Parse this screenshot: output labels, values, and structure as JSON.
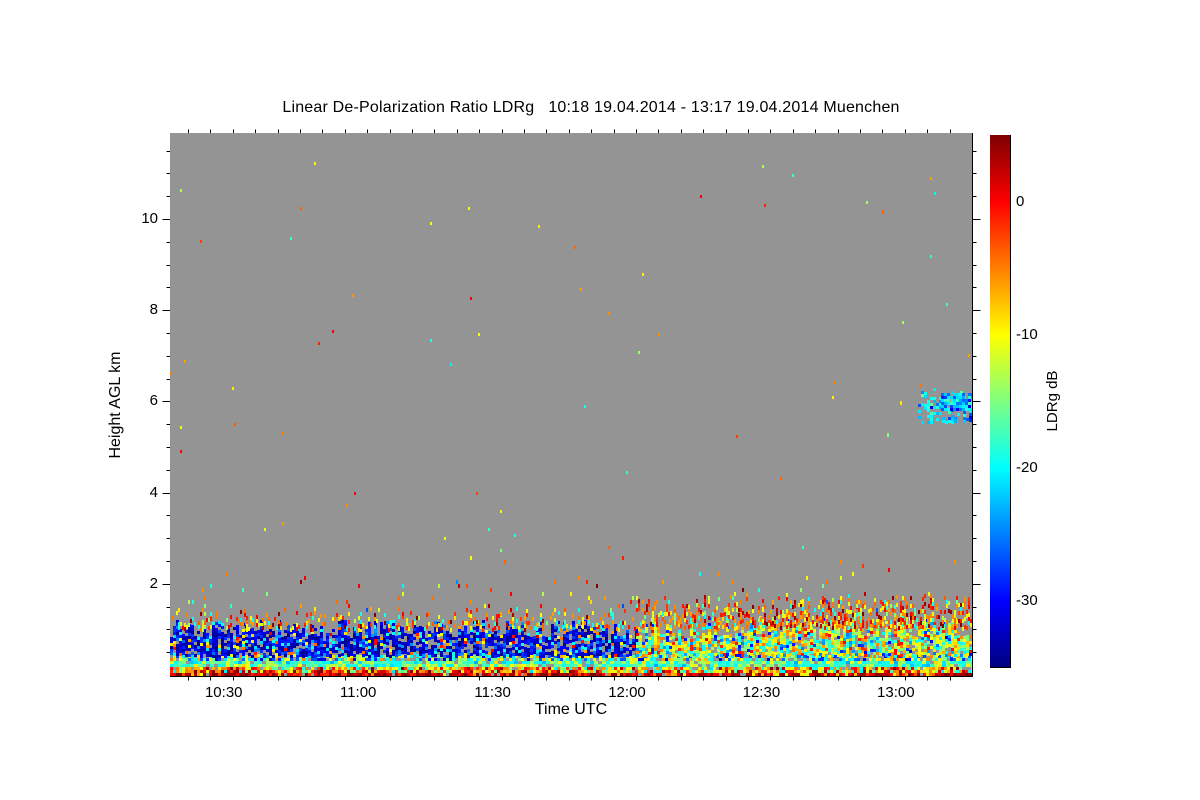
{
  "chart": {
    "title": "Linear De-Polarization Ratio LDRg   10:18 19.04.2014 - 13:17 19.04.2014 Muenchen",
    "x_axis": {
      "label": "Time UTC",
      "start_time": "10:18",
      "end_time": "13:17",
      "duration_min": 179,
      "major_ticks": [
        {
          "label": "10:30",
          "t_min": 12
        },
        {
          "label": "11:00",
          "t_min": 42
        },
        {
          "label": "11:30",
          "t_min": 72
        },
        {
          "label": "12:00",
          "t_min": 102
        },
        {
          "label": "12:30",
          "t_min": 132
        },
        {
          "label": "13:00",
          "t_min": 162
        }
      ],
      "minor_tick_every_min": 5
    },
    "y_axis": {
      "label": "Height AGL km",
      "min_km": 0,
      "max_km": 11.9,
      "major_ticks": [
        2,
        4,
        6,
        8,
        10
      ],
      "minor_tick_every_km": 0.5
    },
    "colorbar": {
      "label": "LDRg dB",
      "max_db": 5,
      "min_db": -35,
      "major_ticks": [
        0,
        -10,
        -20,
        -30
      ],
      "minor_tick_every_db": 2,
      "colormap": "jet"
    },
    "colors": {
      "background": "#ffffff",
      "plot_no_data": "#949494",
      "axis": "#000000",
      "text": "#000000"
    }
  },
  "chart_data": {
    "type": "heatmap",
    "quantity": "Linear De-Polarization Ratio LDRg (dB)",
    "site": "Muenchen",
    "date": "19.04.2014",
    "time_range_utc": [
      "10:18",
      "13:17"
    ],
    "height_range_km": [
      0,
      11.9
    ],
    "value_range_db": [
      -35,
      5
    ],
    "no_data": "grey above boundary layer except isolated specks and one mid-level cloud patch",
    "bands": [
      {
        "name": "surface-clutter-line",
        "t": [
          0,
          179
        ],
        "h": [
          0.0,
          0.1
        ],
        "fill": 0.97,
        "cell": [
          3,
          3
        ],
        "values": [
          [
            4,
            0.5
          ],
          [
            1,
            0.25
          ],
          [
            -2,
            0.12
          ],
          [
            -6,
            0.08
          ],
          [
            -10,
            0.05
          ]
        ]
      },
      {
        "name": "near-surface-mixed",
        "t": [
          0,
          179
        ],
        "h": [
          0.1,
          0.18
        ],
        "fill": 0.85,
        "cell": [
          3,
          3
        ],
        "values": [
          [
            -6,
            0.25
          ],
          [
            -10,
            0.25
          ],
          [
            -1,
            0.18
          ],
          [
            4,
            0.1
          ],
          [
            -16,
            0.12
          ],
          [
            -20,
            0.1
          ]
        ]
      },
      {
        "name": "low-cyan-green-stripe",
        "t": [
          0,
          179
        ],
        "h": [
          0.18,
          0.31
        ],
        "fill": 0.92,
        "cell": [
          4,
          3
        ],
        "values": [
          [
            -19,
            0.4
          ],
          [
            -16,
            0.25
          ],
          [
            -13,
            0.18
          ],
          [
            -10,
            0.1
          ],
          [
            -22,
            0.07
          ]
        ]
      },
      {
        "name": "transition-stripe",
        "t": [
          0,
          179
        ],
        "h": [
          0.31,
          0.44
        ],
        "fill": 0.8,
        "cell": [
          3,
          3
        ],
        "values": [
          [
            -20,
            0.25
          ],
          [
            -10,
            0.22
          ],
          [
            -27,
            0.18
          ],
          [
            -15,
            0.15
          ],
          [
            -6,
            0.1
          ],
          [
            -31,
            0.1
          ]
        ]
      },
      {
        "name": "boundary-layer-blue-morning",
        "t": [
          0,
          104
        ],
        "h": [
          0.44,
          1.02
        ],
        "fill": 0.86,
        "cell": [
          3,
          3
        ],
        "top_jitter": 0.2,
        "values": [
          [
            -33,
            0.42
          ],
          [
            -29,
            0.28
          ],
          [
            -25,
            0.1
          ],
          [
            -20,
            0.09
          ],
          [
            -10,
            0.05
          ],
          [
            -5,
            0.04
          ],
          [
            0,
            0.02
          ]
        ]
      },
      {
        "name": "boundary-layer-warm-noon",
        "t": [
          104,
          179
        ],
        "h": [
          0.44,
          1.05
        ],
        "fill": 0.86,
        "cell": [
          3,
          3
        ],
        "top_jitter": 0.25,
        "values": [
          [
            -10,
            0.26
          ],
          [
            -19,
            0.22
          ],
          [
            -14,
            0.18
          ],
          [
            -6,
            0.14
          ],
          [
            -1,
            0.07
          ],
          [
            -24,
            0.07
          ],
          [
            -29,
            0.06
          ]
        ]
      },
      {
        "name": "fringe-morning",
        "t": [
          0,
          104
        ],
        "h": [
          1.02,
          1.32
        ],
        "fill": 0.32,
        "cell": [
          2,
          4
        ],
        "top_jitter": 0.18,
        "values": [
          [
            -5,
            0.28
          ],
          [
            -10,
            0.24
          ],
          [
            -1,
            0.2
          ],
          [
            -19,
            0.13
          ],
          [
            4,
            0.08
          ],
          [
            -14,
            0.07
          ]
        ]
      },
      {
        "name": "fringe-noon",
        "t": [
          104,
          179
        ],
        "h": [
          1.05,
          1.55
        ],
        "fill": 0.5,
        "cell": [
          2,
          4
        ],
        "top_jitter": 0.25,
        "values": [
          [
            -5,
            0.32
          ],
          [
            -1,
            0.25
          ],
          [
            -10,
            0.18
          ],
          [
            4,
            0.1
          ],
          [
            -19,
            0.09
          ],
          [
            -14,
            0.06
          ]
        ]
      },
      {
        "name": "sparse-speckle",
        "t": [
          0,
          179
        ],
        "h": [
          1.3,
          2.7
        ],
        "fill": 0.03,
        "cell": [
          2,
          4
        ],
        "decay": true,
        "spikes": true,
        "values": [
          [
            -5,
            0.24
          ],
          [
            -1,
            0.2
          ],
          [
            -10,
            0.2
          ],
          [
            -19,
            0.14
          ],
          [
            -14,
            0.1
          ],
          [
            4,
            0.07
          ],
          [
            -26,
            0.05
          ]
        ]
      },
      {
        "name": "rare-high-speckle",
        "t": [
          0,
          179
        ],
        "h": [
          2.7,
          11.7
        ],
        "fill": 0.0012,
        "cell": [
          2,
          3
        ],
        "values": [
          [
            -5,
            0.3
          ],
          [
            -10,
            0.25
          ],
          [
            -19,
            0.2
          ],
          [
            -1,
            0.15
          ],
          [
            -14,
            0.1
          ]
        ]
      },
      {
        "name": "mid-level-cloud-patch",
        "t": [
          167,
          179
        ],
        "h": [
          5.55,
          6.2
        ],
        "fill": 0.45,
        "cell": [
          3,
          3
        ],
        "top_jitter": 0.1,
        "values": [
          [
            -20,
            0.45
          ],
          [
            -23,
            0.25
          ],
          [
            -26,
            0.15
          ],
          [
            -17,
            0.1
          ],
          [
            -30,
            0.05
          ]
        ]
      },
      {
        "name": "mid-level-cloud-core",
        "t": [
          172,
          179
        ],
        "h": [
          5.85,
          6.18
        ],
        "fill": 0.9,
        "cell": [
          3,
          3
        ],
        "values": [
          [
            -22,
            0.4
          ],
          [
            -26,
            0.3
          ],
          [
            -19,
            0.2
          ],
          [
            -30,
            0.1
          ]
        ]
      }
    ],
    "isolated_points": [
      {
        "t_min": 159,
        "height_km": 10.2,
        "db": -4
      },
      {
        "t_min": 163,
        "height_km": 6.0,
        "db": -9
      },
      {
        "t_min": 160,
        "height_km": 5.3,
        "db": -15
      },
      {
        "t_min": 118,
        "height_km": 2.26,
        "db": -20
      },
      {
        "t_min": 66,
        "height_km": 2.0,
        "db": -3
      }
    ]
  }
}
